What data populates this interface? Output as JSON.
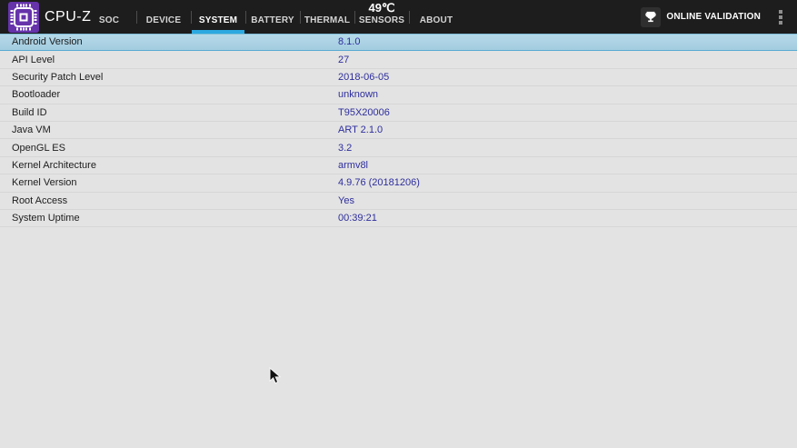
{
  "app": {
    "title": "CPU-Z"
  },
  "header": {
    "temperature": "49℃",
    "tabs": [
      {
        "label": "SOC"
      },
      {
        "label": "DEVICE"
      },
      {
        "label": "SYSTEM"
      },
      {
        "label": "BATTERY"
      },
      {
        "label": "THERMAL"
      },
      {
        "label": "SENSORS"
      },
      {
        "label": "ABOUT"
      }
    ],
    "active_tab": "SYSTEM",
    "online_validation_label": "ONLINE VALIDATION",
    "icons": {
      "logo": "cpu-chip-icon",
      "validation": "trophy-icon",
      "menu": "overflow-menu-icon"
    }
  },
  "system_info": {
    "rows": [
      {
        "label": "Android Version",
        "value": "8.1.0",
        "selected": true
      },
      {
        "label": "API Level",
        "value": "27",
        "selected": false
      },
      {
        "label": "Security Patch Level",
        "value": "2018-06-05",
        "selected": false
      },
      {
        "label": "Bootloader",
        "value": "unknown",
        "selected": false
      },
      {
        "label": "Build ID",
        "value": "T95X20006",
        "selected": false
      },
      {
        "label": "Java VM",
        "value": "ART 2.1.0",
        "selected": false
      },
      {
        "label": "OpenGL ES",
        "value": "3.2",
        "selected": false
      },
      {
        "label": "Kernel Architecture",
        "value": "armv8l",
        "selected": false
      },
      {
        "label": "Kernel Version",
        "value": "4.9.76 (20181206)",
        "selected": false
      },
      {
        "label": "Root Access",
        "value": "Yes",
        "selected": false
      },
      {
        "label": "System Uptime",
        "value": "00:39:21",
        "selected": false
      }
    ]
  },
  "colors": {
    "accent_underline": "#2ba9e0",
    "topbar_background": "#1d1d1d",
    "table_background": "#e3e3e3",
    "selected_row": "#a8d0e2",
    "selected_row_border": "#58a9d2",
    "value_text": "#2e2e9e",
    "logo_purple": "#6633ab"
  }
}
